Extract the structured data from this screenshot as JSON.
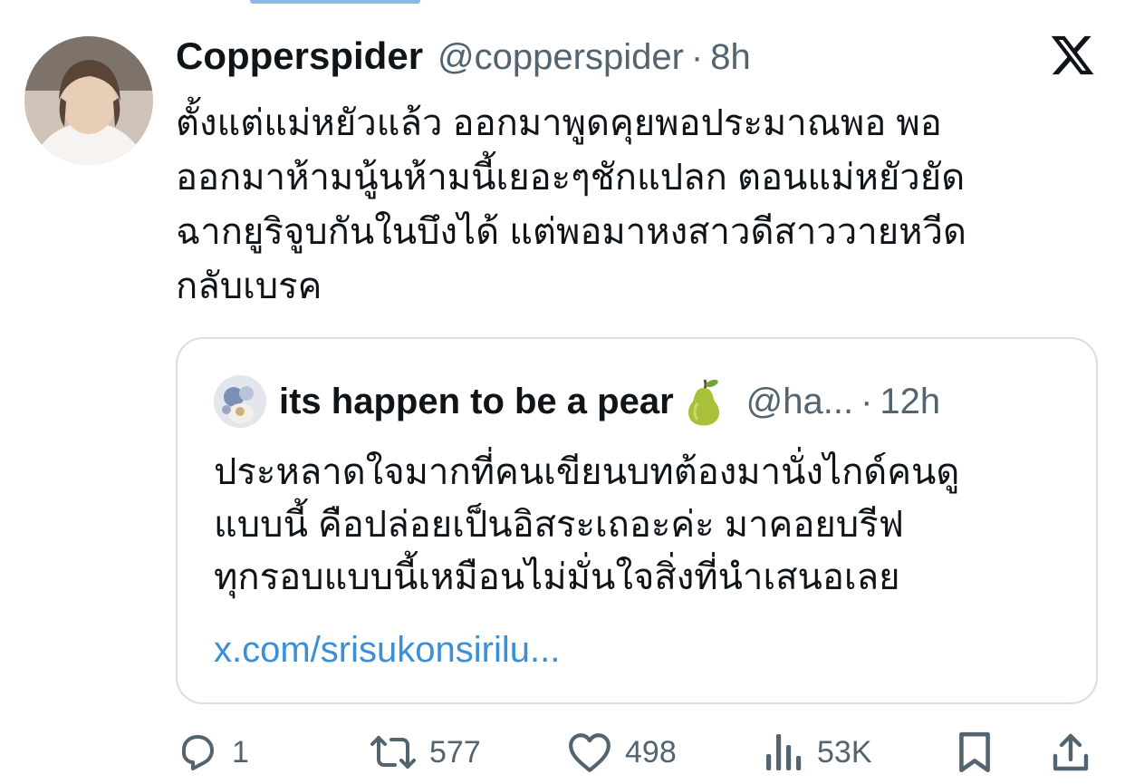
{
  "tweet": {
    "author": {
      "display_name": "Copperspider",
      "handle": "@copperspider",
      "separator": "·",
      "time": "8h"
    },
    "text_lines": [
      "ตั้งแต่แม่หยัวแล้ว ออกมาพูดคุยพอประมาณพอ พอ",
      "ออกมาห้ามนู้นห้ามนี้เยอะๆชักแปลก ตอนแม่หยัวยัด",
      "ฉากยูริจูบกันในบึงได้ แต่พอมาหงสาวดีสาววายหวีด",
      "กลับเบรค"
    ],
    "brand_icon": "x-logo-icon"
  },
  "quote": {
    "author": {
      "display_name": "its happen to be a pear",
      "emoji_icon": "pear-icon",
      "handle": "@ha...",
      "separator": "·",
      "time": "12h"
    },
    "text_lines": [
      "ประหลาดใจมากที่คนเขียนบทต้องมานั่งไกด์คนดู",
      "แบบนี้ คือปล่อยเป็นอิสระเถอะค่ะ มาคอยบรีฟ",
      "ทุกรอบแบบนี้เหมือนไม่มั่นใจสิ่งที่นำเสนอเลย"
    ],
    "link": "x.com/srisukonsirilu..."
  },
  "actions": {
    "reply": {
      "icon": "reply-icon",
      "count": "1"
    },
    "repost": {
      "icon": "repost-icon",
      "count": "577"
    },
    "like": {
      "icon": "heart-icon",
      "count": "498"
    },
    "views": {
      "icon": "views-icon",
      "count": "53K"
    },
    "bookmark": {
      "icon": "bookmark-icon"
    },
    "share": {
      "icon": "share-icon"
    }
  },
  "colors": {
    "text_primary": "#0f1419",
    "text_secondary": "#536471",
    "link": "#3b8fd6",
    "border": "#d9dee2"
  }
}
